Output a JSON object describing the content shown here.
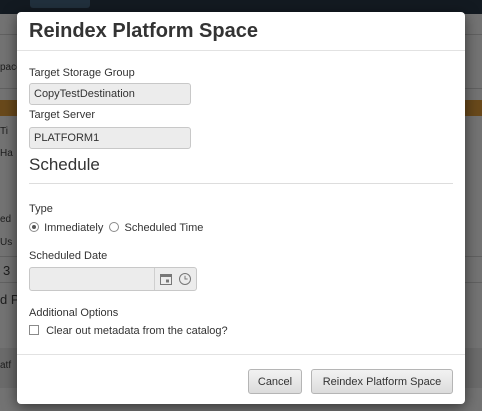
{
  "background": {
    "fragments": [
      "pace",
      "Ti",
      "Ha",
      "ed",
      "Us",
      "3",
      "d P",
      "atf"
    ]
  },
  "dialog": {
    "title": "Reindex Platform Space",
    "target_storage_group": {
      "label": "Target Storage Group",
      "value": "CopyTestDestination"
    },
    "target_server": {
      "label": "Target Server",
      "value": "PLATFORM1"
    },
    "schedule": {
      "heading": "Schedule",
      "type_label": "Type",
      "options": [
        {
          "label": "Immediately",
          "checked": true
        },
        {
          "label": "Scheduled Time",
          "checked": false
        }
      ],
      "scheduled_date_label": "Scheduled Date",
      "scheduled_date_value": ""
    },
    "additional_options": {
      "label": "Additional Options",
      "clear_metadata": {
        "label": "Clear out metadata from the catalog?",
        "checked": false
      }
    },
    "buttons": {
      "cancel": "Cancel",
      "submit": "Reindex Platform Space"
    }
  },
  "icons": {
    "calendar": "calendar-icon",
    "clock": "clock-icon"
  },
  "colors": {
    "overlay": "#000000",
    "accent_orange": "#e8a33c",
    "input_bg": "#ececec"
  }
}
